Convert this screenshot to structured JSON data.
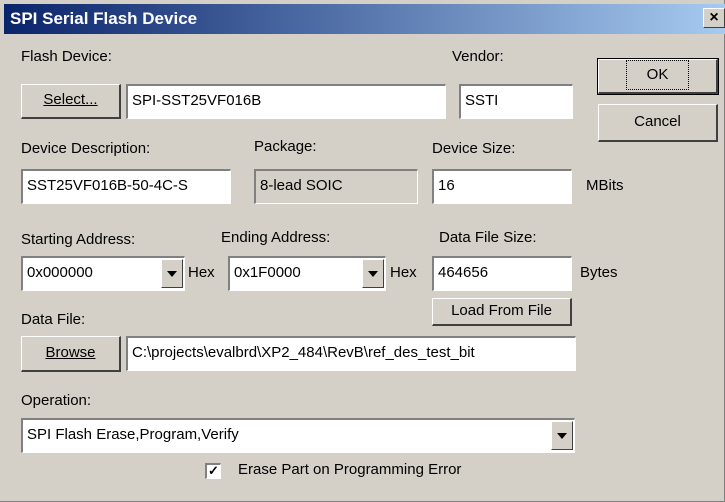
{
  "window": {
    "title": "SPI Serial Flash Device",
    "close_glyph": "×"
  },
  "flash_device": {
    "label": "Flash Device:",
    "select_button": "Select...",
    "value": "SPI-SST25VF016B"
  },
  "vendor": {
    "label": "Vendor:",
    "value": "SSTI"
  },
  "buttons": {
    "ok": "OK",
    "cancel": "Cancel",
    "load_from_file": "Load From File",
    "browse": "Browse"
  },
  "device_description": {
    "label": "Device Description:",
    "value": "SST25VF016B-50-4C-S"
  },
  "package": {
    "label": "Package:",
    "value": "8-lead SOIC"
  },
  "device_size": {
    "label": "Device Size:",
    "value": "16",
    "unit": "MBits"
  },
  "starting_address": {
    "label": "Starting Address:",
    "value": "0x000000",
    "suffix": "Hex"
  },
  "ending_address": {
    "label": "Ending Address:",
    "value": "0x1F0000",
    "suffix": "Hex"
  },
  "data_file_size": {
    "label": "Data File Size:",
    "value": "464656",
    "unit": "Bytes"
  },
  "data_file": {
    "label": "Data File:",
    "value": "C:\\projects\\evalbrd\\XP2_484\\RevB\\ref_des_test_bit"
  },
  "operation": {
    "label": "Operation:",
    "value": "SPI Flash Erase,Program,Verify"
  },
  "erase_on_error": {
    "label": "Erase Part on Programming Error",
    "checked": true,
    "check_glyph": "✓"
  }
}
